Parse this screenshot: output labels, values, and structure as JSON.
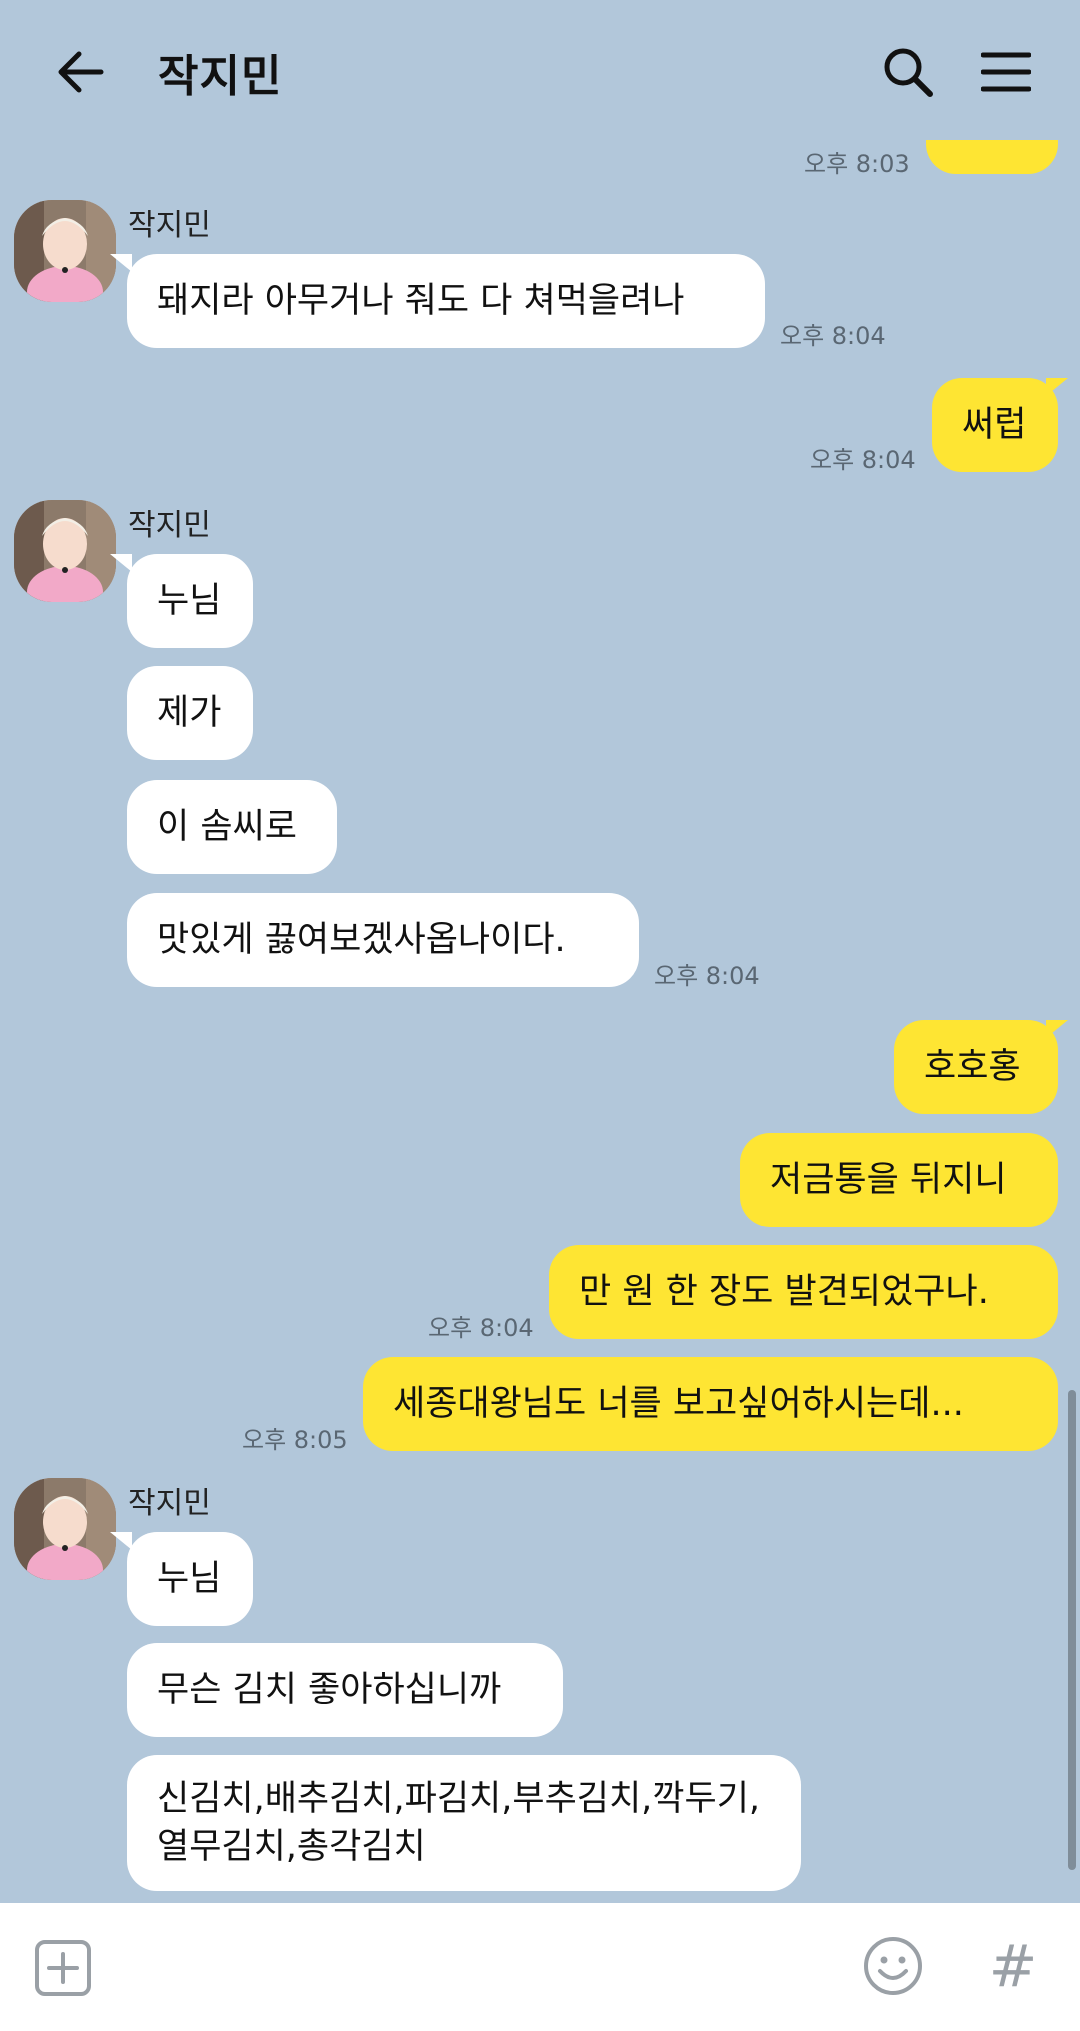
{
  "header": {
    "title": "작지민"
  },
  "messages": {
    "m0_time": "오후 8:03",
    "g1_sender": "작지민",
    "m1_text": "돼지라 아무거나 줘도 다 쳐먹을려나",
    "m1_time": "오후 8:04",
    "m2_text": "써럽",
    "m2_time": "오후 8:04",
    "g2_sender": "작지민",
    "m3_text": "누님",
    "m4_text": "제가",
    "m5_text": "이 솜씨로",
    "m6_text": "맛있게 끓여보겠사옵나이다.",
    "m6_time": "오후 8:04",
    "m7_text": "호호홍",
    "m8_text": "저금통을 뒤지니",
    "m9_text": "만 원 한 장도 발견되었구나.",
    "m9_time": "오후 8:04",
    "m10_text": "세종대왕님도 너를 보고싶어하시는데...",
    "m10_time": "오후 8:05",
    "g3_sender": "작지민",
    "m11_text": "누님",
    "m12_text": "무슨 김치 좋아하십니까",
    "m13_text": "신김치,배추김치,파김치,부추김치,깍두기,열무김치,총각김치"
  },
  "bottom": {
    "hash_label": "#"
  },
  "colors": {
    "background": "#b2c7da",
    "my_bubble": "#fee533",
    "their_bubble": "#ffffff"
  },
  "icons": [
    "back-arrow-icon",
    "search-icon",
    "menu-icon",
    "plus-icon",
    "emoji-icon",
    "hash-icon"
  ]
}
